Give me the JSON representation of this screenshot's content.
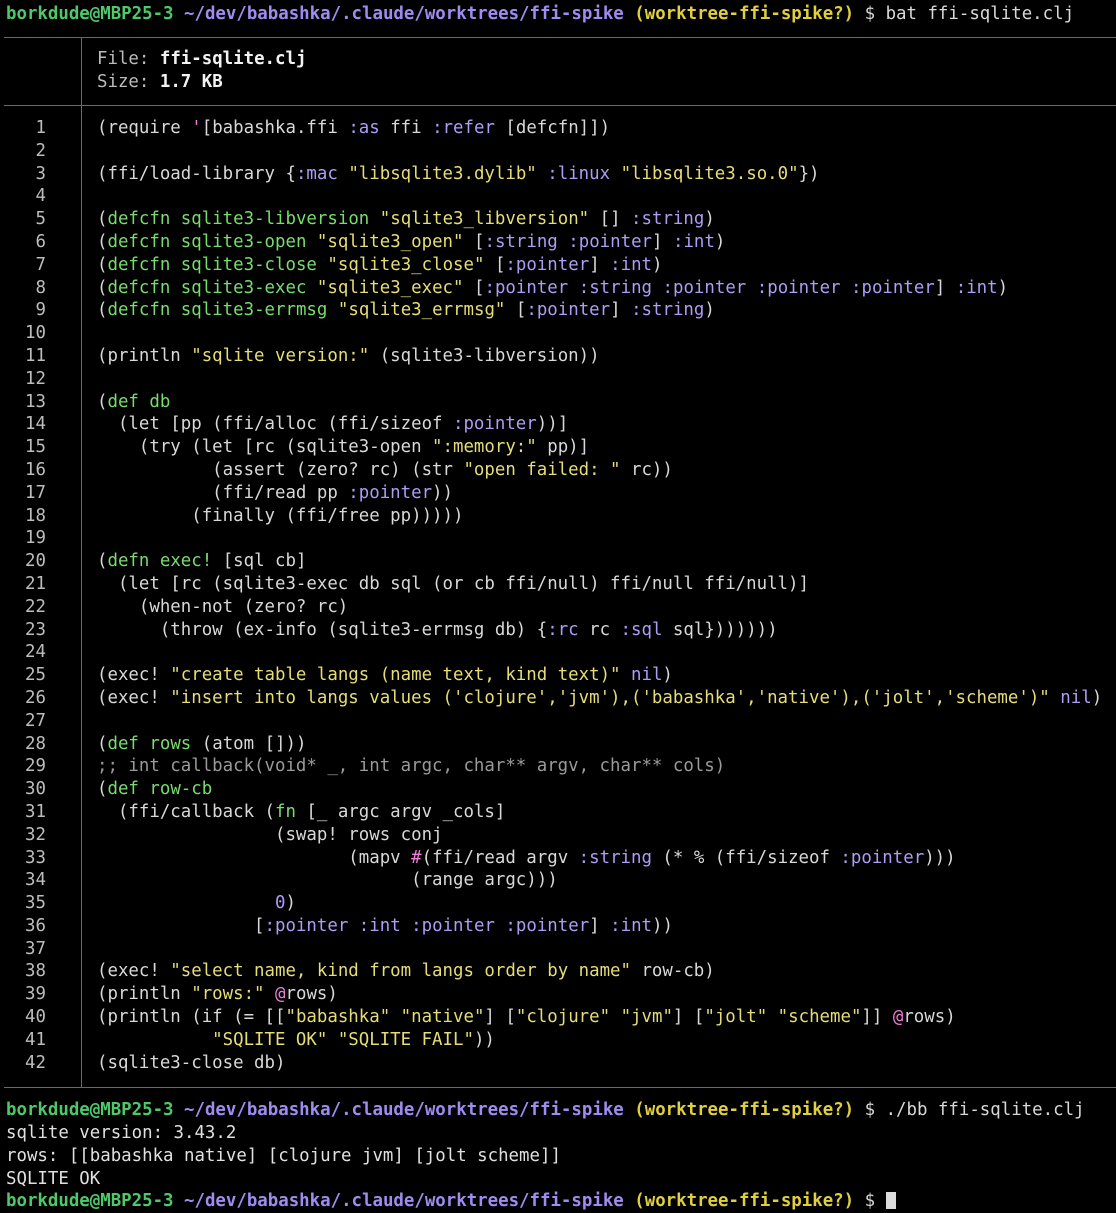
{
  "prompt": {
    "user_host": "borkdude@MBP25-3",
    "path": "~/dev/babashka/.claude/worktrees/ffi-spike",
    "branch": "(worktree-ffi-spike?)",
    "symbol": "$"
  },
  "commands": {
    "first": "bat ffi-sqlite.clj",
    "second": "./bb ffi-sqlite.clj"
  },
  "file_header": {
    "file_label": "File:",
    "file_name": "ffi-sqlite.clj",
    "size_label": "Size:",
    "size_value": "1.7 KB"
  },
  "code_lines": [
    [
      [
        "p",
        "(require "
      ],
      [
        "q",
        "'"
      ],
      [
        "p",
        "[babashka.ffi "
      ],
      [
        "kwd",
        ":as"
      ],
      [
        "p",
        " ffi "
      ],
      [
        "kwd",
        ":refer"
      ],
      [
        "p",
        " [defcfn]])"
      ]
    ],
    [],
    [
      [
        "p",
        "(ffi/load-library {"
      ],
      [
        "kwd",
        ":mac"
      ],
      [
        "p",
        " "
      ],
      [
        "str",
        "\"libsqlite3.dylib\""
      ],
      [
        "p",
        " "
      ],
      [
        "kwd",
        ":linux"
      ],
      [
        "p",
        " "
      ],
      [
        "str",
        "\"libsqlite3.so.0\""
      ],
      [
        "p",
        "})"
      ]
    ],
    [],
    [
      [
        "p",
        "("
      ],
      [
        "kw",
        "defcfn"
      ],
      [
        "p",
        " "
      ],
      [
        "name",
        "sqlite3-libversion"
      ],
      [
        "p",
        " "
      ],
      [
        "str",
        "\"sqlite3_libversion\""
      ],
      [
        "p",
        " [] "
      ],
      [
        "kwd",
        ":string"
      ],
      [
        "p",
        ")"
      ]
    ],
    [
      [
        "p",
        "("
      ],
      [
        "kw",
        "defcfn"
      ],
      [
        "p",
        " "
      ],
      [
        "name",
        "sqlite3-open"
      ],
      [
        "p",
        " "
      ],
      [
        "str",
        "\"sqlite3_open\""
      ],
      [
        "p",
        " ["
      ],
      [
        "kwd",
        ":string"
      ],
      [
        "p",
        " "
      ],
      [
        "kwd",
        ":pointer"
      ],
      [
        "p",
        "] "
      ],
      [
        "kwd",
        ":int"
      ],
      [
        "p",
        ")"
      ]
    ],
    [
      [
        "p",
        "("
      ],
      [
        "kw",
        "defcfn"
      ],
      [
        "p",
        " "
      ],
      [
        "name",
        "sqlite3-close"
      ],
      [
        "p",
        " "
      ],
      [
        "str",
        "\"sqlite3_close\""
      ],
      [
        "p",
        " ["
      ],
      [
        "kwd",
        ":pointer"
      ],
      [
        "p",
        "] "
      ],
      [
        "kwd",
        ":int"
      ],
      [
        "p",
        ")"
      ]
    ],
    [
      [
        "p",
        "("
      ],
      [
        "kw",
        "defcfn"
      ],
      [
        "p",
        " "
      ],
      [
        "name",
        "sqlite3-exec"
      ],
      [
        "p",
        " "
      ],
      [
        "str",
        "\"sqlite3_exec\""
      ],
      [
        "p",
        " ["
      ],
      [
        "kwd",
        ":pointer"
      ],
      [
        "p",
        " "
      ],
      [
        "kwd",
        ":string"
      ],
      [
        "p",
        " "
      ],
      [
        "kwd",
        ":pointer"
      ],
      [
        "p",
        " "
      ],
      [
        "kwd",
        ":pointer"
      ],
      [
        "p",
        " "
      ],
      [
        "kwd",
        ":pointer"
      ],
      [
        "p",
        "] "
      ],
      [
        "kwd",
        ":int"
      ],
      [
        "p",
        ")"
      ]
    ],
    [
      [
        "p",
        "("
      ],
      [
        "kw",
        "defcfn"
      ],
      [
        "p",
        " "
      ],
      [
        "name",
        "sqlite3-errmsg"
      ],
      [
        "p",
        " "
      ],
      [
        "str",
        "\"sqlite3_errmsg\""
      ],
      [
        "p",
        " ["
      ],
      [
        "kwd",
        ":pointer"
      ],
      [
        "p",
        "] "
      ],
      [
        "kwd",
        ":string"
      ],
      [
        "p",
        ")"
      ]
    ],
    [],
    [
      [
        "p",
        "(println "
      ],
      [
        "str",
        "\"sqlite version:\""
      ],
      [
        "p",
        " (sqlite3-libversion))"
      ]
    ],
    [],
    [
      [
        "p",
        "("
      ],
      [
        "kw",
        "def"
      ],
      [
        "p",
        " "
      ],
      [
        "name",
        "db"
      ]
    ],
    [
      [
        "p",
        "  (let [pp (ffi/alloc (ffi/sizeof "
      ],
      [
        "kwd",
        ":pointer"
      ],
      [
        "p",
        "))]"
      ]
    ],
    [
      [
        "p",
        "    (try (let [rc (sqlite3-open "
      ],
      [
        "str",
        "\":memory:\""
      ],
      [
        "p",
        " pp)]"
      ]
    ],
    [
      [
        "p",
        "           (assert (zero? rc) (str "
      ],
      [
        "str",
        "\"open failed: \""
      ],
      [
        "p",
        " rc))"
      ]
    ],
    [
      [
        "p",
        "           (ffi/read pp "
      ],
      [
        "kwd",
        ":pointer"
      ],
      [
        "p",
        "))"
      ]
    ],
    [
      [
        "p",
        "         (finally (ffi/free pp)))))"
      ]
    ],
    [],
    [
      [
        "p",
        "("
      ],
      [
        "kw",
        "defn"
      ],
      [
        "p",
        " "
      ],
      [
        "name",
        "exec!"
      ],
      [
        "p",
        " [sql cb]"
      ]
    ],
    [
      [
        "p",
        "  (let [rc (sqlite3-exec db sql (or cb ffi/null) ffi/null ffi/null)]"
      ]
    ],
    [
      [
        "p",
        "    (when-not (zero? rc)"
      ]
    ],
    [
      [
        "p",
        "      (throw (ex-info (sqlite3-errmsg db) {"
      ],
      [
        "kwd",
        ":rc"
      ],
      [
        "p",
        " rc "
      ],
      [
        "kwd",
        ":sql"
      ],
      [
        "p",
        " sql}))))))"
      ]
    ],
    [],
    [
      [
        "p",
        "(exec! "
      ],
      [
        "str",
        "\"create table langs (name text, kind text)\""
      ],
      [
        "p",
        " "
      ],
      [
        "nil",
        "nil"
      ],
      [
        "p",
        ")"
      ]
    ],
    [
      [
        "p",
        "(exec! "
      ],
      [
        "str",
        "\"insert into langs values ('clojure','jvm'),('babashka','native'),('jolt','scheme')\""
      ],
      [
        "p",
        " "
      ],
      [
        "nil",
        "nil"
      ],
      [
        "p",
        ")"
      ]
    ],
    [],
    [
      [
        "p",
        "("
      ],
      [
        "kw",
        "def"
      ],
      [
        "p",
        " "
      ],
      [
        "name",
        "rows"
      ],
      [
        "p",
        " (atom []))"
      ]
    ],
    [
      [
        "cmt",
        ";; int callback(void* _, int argc, char** argv, char** cols)"
      ]
    ],
    [
      [
        "p",
        "("
      ],
      [
        "kw",
        "def"
      ],
      [
        "p",
        " "
      ],
      [
        "name",
        "row-cb"
      ]
    ],
    [
      [
        "p",
        "  (ffi/callback ("
      ],
      [
        "kw",
        "fn"
      ],
      [
        "p",
        " [_ argc argv _cols]"
      ]
    ],
    [
      [
        "p",
        "                 (swap! rows conj"
      ]
    ],
    [
      [
        "p",
        "                        (mapv "
      ],
      [
        "q",
        "#"
      ],
      [
        "p",
        "(ffi/read argv "
      ],
      [
        "kwd",
        ":string"
      ],
      [
        "p",
        " (* % (ffi/sizeof "
      ],
      [
        "kwd",
        ":pointer"
      ],
      [
        "p",
        ")))"
      ]
    ],
    [
      [
        "p",
        "                              (range argc)))"
      ]
    ],
    [
      [
        "p",
        "                 "
      ],
      [
        "num",
        "0"
      ],
      [
        "p",
        ")"
      ]
    ],
    [
      [
        "p",
        "               ["
      ],
      [
        "kwd",
        ":pointer"
      ],
      [
        "p",
        " "
      ],
      [
        "kwd",
        ":int"
      ],
      [
        "p",
        " "
      ],
      [
        "kwd",
        ":pointer"
      ],
      [
        "p",
        " "
      ],
      [
        "kwd",
        ":pointer"
      ],
      [
        "p",
        "] "
      ],
      [
        "kwd",
        ":int"
      ],
      [
        "p",
        "))"
      ]
    ],
    [],
    [
      [
        "p",
        "(exec! "
      ],
      [
        "str",
        "\"select name, kind from langs order by name\""
      ],
      [
        "p",
        " row-cb)"
      ]
    ],
    [
      [
        "p",
        "(println "
      ],
      [
        "str",
        "\"rows:\""
      ],
      [
        "p",
        " "
      ],
      [
        "at",
        "@"
      ],
      [
        "p",
        "rows)"
      ]
    ],
    [
      [
        "p",
        "(println (if (= [["
      ],
      [
        "str",
        "\"babashka\""
      ],
      [
        "p",
        " "
      ],
      [
        "str",
        "\"native\""
      ],
      [
        "p",
        "] ["
      ],
      [
        "str",
        "\"clojure\""
      ],
      [
        "p",
        " "
      ],
      [
        "str",
        "\"jvm\""
      ],
      [
        "p",
        "] ["
      ],
      [
        "str",
        "\"jolt\""
      ],
      [
        "p",
        " "
      ],
      [
        "str",
        "\"scheme\""
      ],
      [
        "p",
        "]] "
      ],
      [
        "at",
        "@"
      ],
      [
        "p",
        "rows)"
      ]
    ],
    [
      [
        "p",
        "           "
      ],
      [
        "str",
        "\"SQLITE OK\""
      ],
      [
        "p",
        " "
      ],
      [
        "str",
        "\"SQLITE FAIL\""
      ],
      [
        "p",
        "))"
      ]
    ],
    [
      [
        "p",
        "(sqlite3-close db)"
      ]
    ]
  ],
  "output_lines": [
    "sqlite version: 3.43.2",
    "rows: [[babashka native] [clojure jvm] [jolt scheme]]",
    "SQLITE OK"
  ],
  "colors": {
    "background": "#000000",
    "prompt_user": "#4ec96a",
    "prompt_path": "#a08cf0",
    "prompt_branch": "#e0cf3e",
    "string": "#e5dd77",
    "keyword": "#ae9cf5",
    "special_form": "#78dc6e",
    "comment": "#9a9a9a",
    "reader_macro": "#ef7fd8"
  }
}
